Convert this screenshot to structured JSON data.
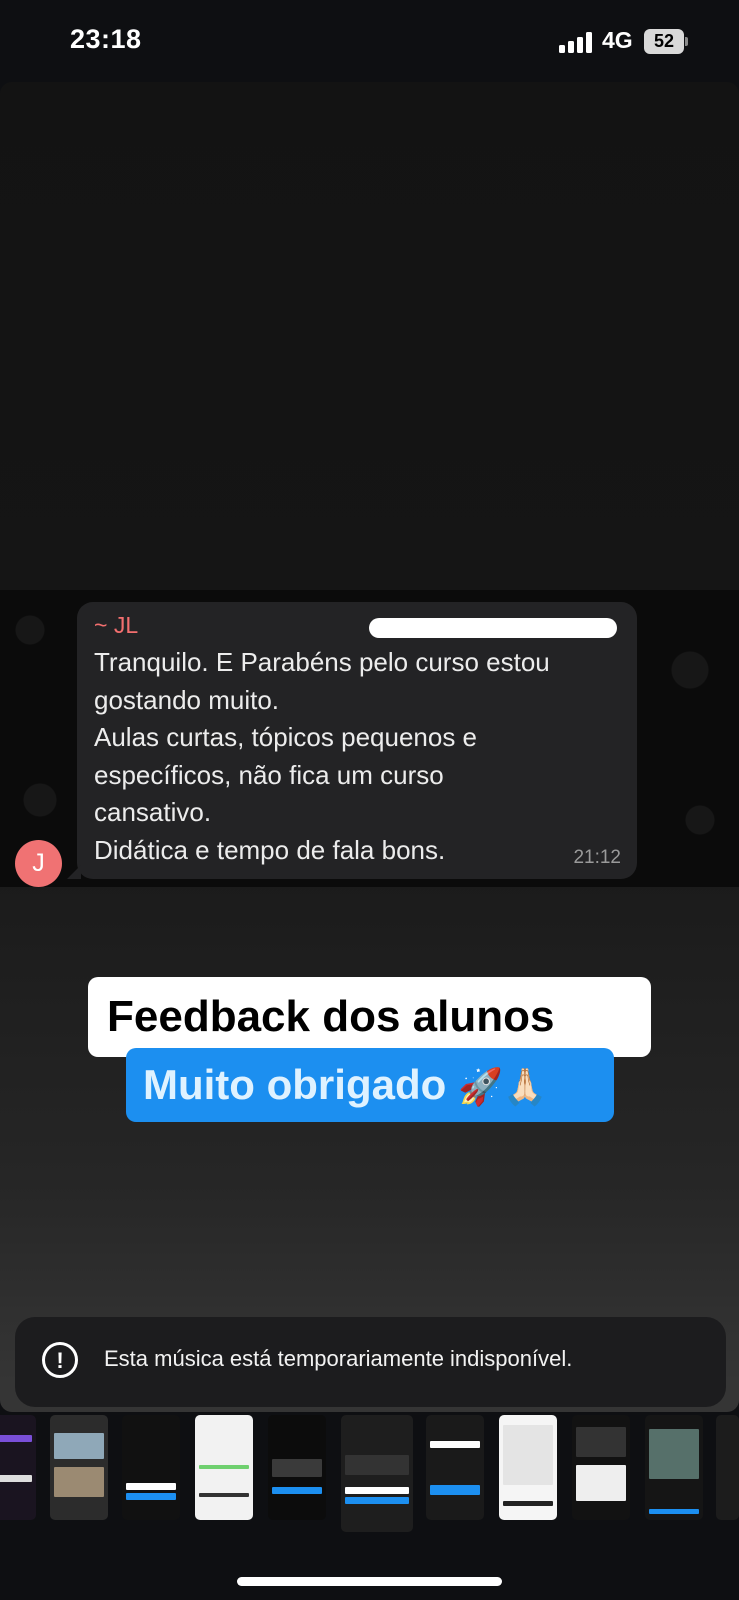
{
  "status": {
    "time": "23:18",
    "network": "4G",
    "battery": "52"
  },
  "message": {
    "sender": "~ JL",
    "lines": [
      "Tranquilo. E Parabéns pelo curso estou",
      "gostando muito.",
      "Aulas curtas, tópicos pequenos e",
      "específicos, não fica um curso",
      "cansativo.",
      "Didática e tempo de fala bons."
    ],
    "time": "21:12",
    "avatar_letter": "J"
  },
  "captions": {
    "title": "Feedback dos alunos",
    "subtitle": "Muito obrigado",
    "subtitle_emoji": "🚀🙏🏻"
  },
  "toast": {
    "text": "Esta música está temporariamente indisponível.",
    "icon": "exclamation-circle-icon"
  },
  "thumbnails": [
    {
      "label": "",
      "bg": "#1a1420"
    },
    {
      "label": "",
      "bg": "#2c2c2c"
    },
    {
      "label": "Muito obrigado",
      "bg": "#111111"
    },
    {
      "label": "Feedback dos alunos",
      "bg": "#f2f2f2"
    },
    {
      "label": "",
      "bg": "#0c0c0c"
    },
    {
      "label": "Feedback dos alunos",
      "bg": "#1e1e1e"
    },
    {
      "label": "Feedback dos alunos",
      "bg": "#1a1a1a"
    },
    {
      "label": "Depoimentos dos nossos alunos",
      "bg": "#f5f5f5"
    },
    {
      "label": "Feedback que motiva",
      "bg": "#121212"
    },
    {
      "label": "Feedback dos alunos",
      "bg": "#151515"
    },
    {
      "label": "",
      "bg": "#1c1c1c"
    }
  ],
  "colors": {
    "accent": "#1c8ff0",
    "sender": "#f36f6f",
    "avatar": "#f07273"
  }
}
